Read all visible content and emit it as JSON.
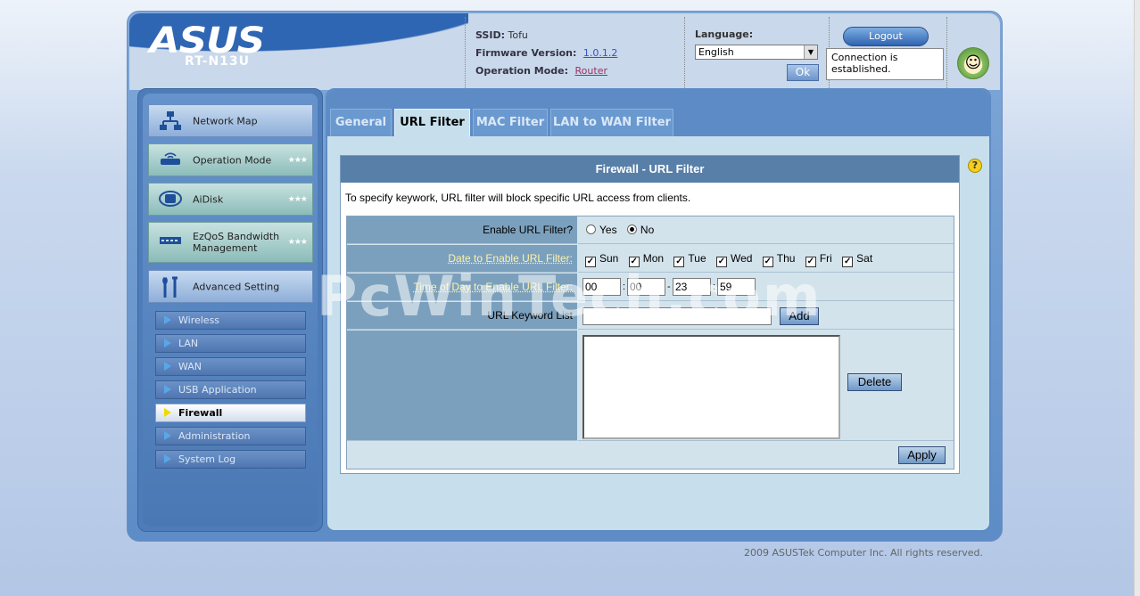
{
  "brand": {
    "logo": "ASUS",
    "model": "RT-N13U"
  },
  "info": {
    "ssid_label": "SSID:",
    "ssid_value": "Tofu",
    "firmware_label": "Firmware Version:",
    "firmware_value": "1.0.1.2",
    "opmode_label": "Operation Mode:",
    "opmode_value": "Router"
  },
  "language": {
    "label": "Language:",
    "selected": "English",
    "ok_label": "Ok"
  },
  "logout_label": "Logout",
  "connection_status": "Connection is established.",
  "sidebar": {
    "main_items": [
      {
        "label": "Network Map",
        "icon": "network-map-icon"
      },
      {
        "label": "Operation Mode",
        "icon": "router-icon"
      },
      {
        "label": "AiDisk",
        "icon": "disk-icon"
      },
      {
        "label": "EzQoS Bandwidth Management",
        "icon": "qos-icon"
      },
      {
        "label": "Advanced Setting",
        "icon": "tools-icon"
      }
    ],
    "sub_items": [
      {
        "label": "Wireless"
      },
      {
        "label": "LAN"
      },
      {
        "label": "WAN"
      },
      {
        "label": "USB Application"
      },
      {
        "label": "Firewall",
        "active": true
      },
      {
        "label": "Administration"
      },
      {
        "label": "System Log"
      }
    ]
  },
  "tabs": [
    {
      "label": "General"
    },
    {
      "label": "URL Filter",
      "active": true
    },
    {
      "label": "MAC Filter"
    },
    {
      "label": "LAN to WAN Filter"
    }
  ],
  "panel": {
    "title": "Firewall - URL Filter",
    "description": "To specify keywork, URL filter will block specific URL access from clients.",
    "enable_label": "Enable URL Filter?",
    "enable_options": [
      "Yes",
      "No"
    ],
    "enable_selected": "No",
    "date_label": "Date to Enable URL Filter:",
    "days": [
      "Sun",
      "Mon",
      "Tue",
      "Wed",
      "Thu",
      "Fri",
      "Sat"
    ],
    "days_checked": [
      true,
      true,
      true,
      true,
      true,
      true,
      true
    ],
    "time_label": "Time of Day to Enable URL Filter:",
    "time_values": [
      "00",
      "00",
      "23",
      "59"
    ],
    "time_separators": [
      ":",
      "-",
      ":"
    ],
    "keyword_label": "URL Keyword List",
    "keyword_value": "",
    "add_label": "Add",
    "delete_label": "Delete",
    "apply_label": "Apply"
  },
  "watermark": "PcWinTech.com",
  "copyright": "2009 ASUSTek Computer Inc. All rights reserved.",
  "colors": {
    "accent": "#2f66b3",
    "panel_title": "#587fa8",
    "label_bg": "#7ba0bd",
    "link_label": "#fff2a6"
  }
}
